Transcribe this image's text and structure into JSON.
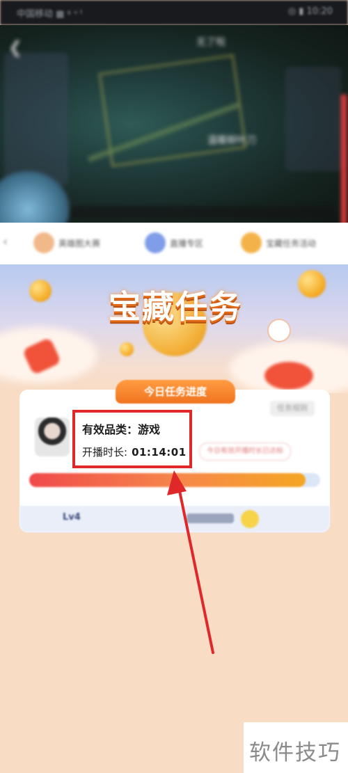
{
  "status_bar": {
    "carrier": "中国移动 ▦ ᵍ ᵘ ᵗ",
    "time": "◎ ▮ 10:20"
  },
  "stream": {
    "title": "无了啦",
    "caption": "温暖柳叶刀"
  },
  "tabs": [
    {
      "label": "英雄图大赛",
      "icon_color": "#f1b88a"
    },
    {
      "label": "直播专区",
      "icon_color": "#7f9de8"
    },
    {
      "label": "宝藏任务活动",
      "icon_color": "#f4b34a"
    }
  ],
  "banner": {
    "title": "宝藏任务"
  },
  "card": {
    "header": "今日任务进度",
    "corner_button": "任务规则",
    "category_label": "有效品类：",
    "category_value": "游戏",
    "duration_label": "开播时长:",
    "duration_value": "01:14:01",
    "status_pill": "今日有效开播时长已达标",
    "progress": 0.95,
    "level_text": "Lv4"
  },
  "watermark": {
    "text": "软件技巧"
  },
  "colors": {
    "highlight": "#e0282b",
    "accent_orange": "#f0731f",
    "page_bg": "#f9dcc4"
  }
}
